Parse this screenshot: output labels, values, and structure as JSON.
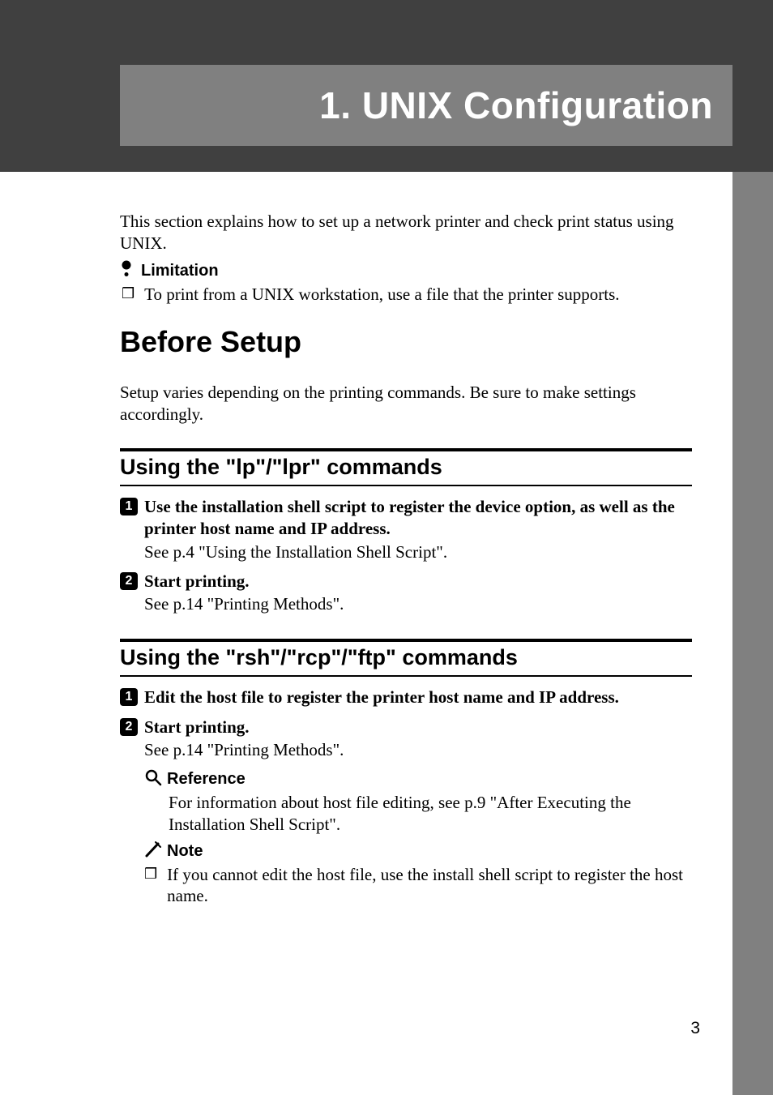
{
  "banner": {
    "chapter_title": "1. UNIX Configuration"
  },
  "intro": "This section explains how to set up a network printer and check print status using UNIX.",
  "limitation": {
    "label": "Limitation",
    "item": "To print from a UNIX workstation, use a file that the printer supports."
  },
  "before_setup": {
    "heading": "Before Setup",
    "text": "Setup varies depending on the printing commands. Be sure to make settings accordingly."
  },
  "section_lp": {
    "heading": "Using the \"lp\"/\"lpr\" commands",
    "step1": "Use the installation shell script to register the device option, as well as the printer host name and IP address.",
    "step1_sub": "See p.4 \"Using the Installation Shell Script\".",
    "step2": "Start printing.",
    "step2_sub": "See p.14 \"Printing Methods\"."
  },
  "section_rsh": {
    "heading": "Using the \"rsh\"/\"rcp\"/\"ftp\" commands",
    "step1": "Edit the host file to register the printer host name and IP address.",
    "step2": "Start printing.",
    "step2_sub": "See p.14 \"Printing Methods\".",
    "reference_label": "Reference",
    "reference_text": "For information about host file editing, see p.9 \"After Executing the Installation Shell Script\".",
    "note_label": "Note",
    "note_text": "If you cannot edit the host file, use the install shell script to register the host name."
  },
  "page_number": "3",
  "bullet_glyph": "❒"
}
